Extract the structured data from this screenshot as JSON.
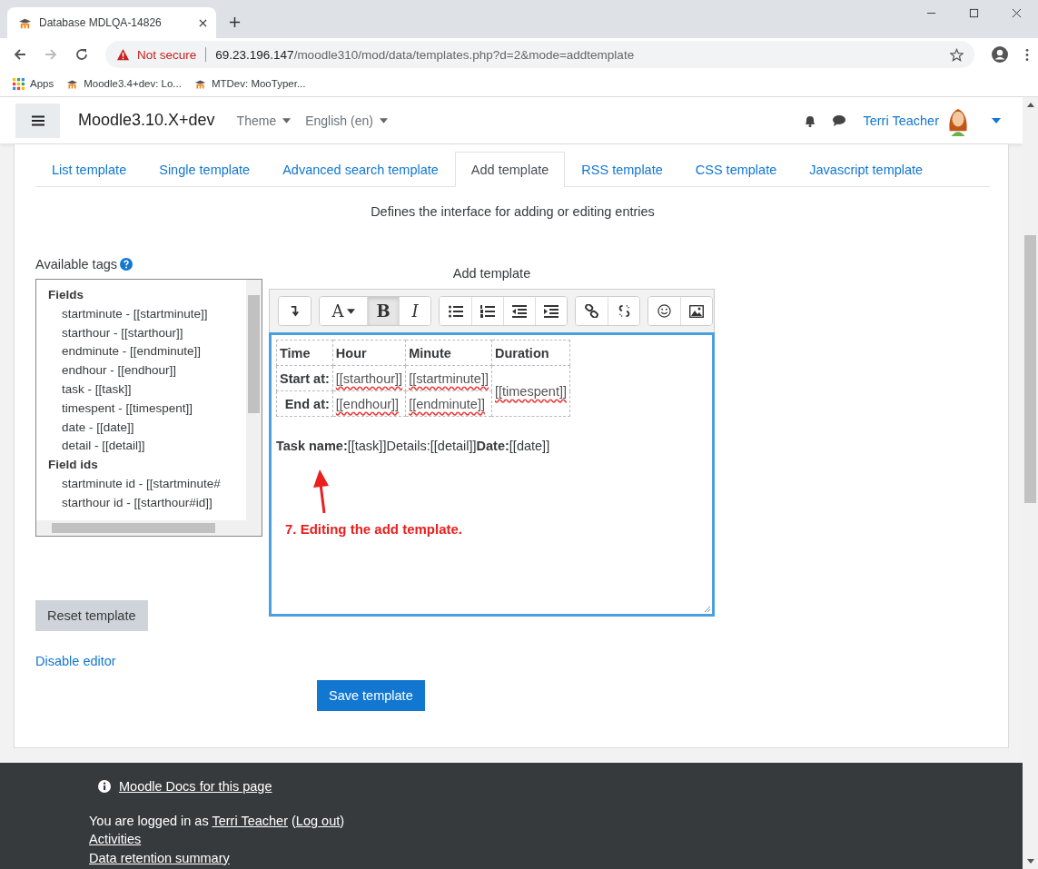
{
  "browser": {
    "tab_title": "Database MDLQA-14826",
    "security": "Not secure",
    "url_host": "69.23.196.147",
    "url_path": "/moodle310/mod/data/templates.php?d=2&mode=addtemplate",
    "bookmarks": [
      "Apps",
      "Moodle3.4+dev: Lo...",
      "MTDev: MooTyper..."
    ]
  },
  "navbar": {
    "site_name": "Moodle3.10.X+dev",
    "menus": [
      "Theme",
      "English (en)"
    ],
    "user": "Terri Teacher"
  },
  "tabs": [
    {
      "label": "List template",
      "selected": false
    },
    {
      "label": "Single template",
      "selected": false
    },
    {
      "label": "Advanced search template",
      "selected": false
    },
    {
      "label": "Add template",
      "selected": true
    },
    {
      "label": "RSS template",
      "selected": false
    },
    {
      "label": "CSS template",
      "selected": false
    },
    {
      "label": "Javascript template",
      "selected": false
    }
  ],
  "description": "Defines the interface for adding or editing entries",
  "available_tags": {
    "label": "Available tags",
    "groups": [
      {
        "heading": "Fields",
        "items": [
          "startminute - [[startminute]]",
          "starthour - [[starthour]]",
          "endminute - [[endminute]]",
          "endhour - [[endhour]]",
          "task - [[task]]",
          "timespent - [[timespent]]",
          "date - [[date]]",
          "detail - [[detail]]"
        ]
      },
      {
        "heading": "Field ids",
        "items": [
          "startminute id - [[startminute#",
          "starthour id - [[starthour#id]]"
        ]
      }
    ]
  },
  "editor": {
    "label": "Add template",
    "toolbar": {
      "font_label": "A",
      "bold_label": "B",
      "italic_label": "I",
      "bold_active": true
    },
    "table": [
      [
        "Time",
        "Hour",
        "Minute",
        "Duration"
      ],
      [
        "Start at:",
        "[[starthour]]",
        "[[startminute]]",
        "[[timespent]]"
      ],
      [
        "End at:",
        "[[endhour]]",
        "[[endminute]]"
      ]
    ],
    "paragraph": "**Task name:**[[task]]Details:[[detail]]**Date:**[[date]]",
    "annotation": "7. Editing the add template."
  },
  "buttons": {
    "reset": "Reset template",
    "disable": "Disable editor",
    "save": "Save template"
  },
  "footer": {
    "docs_link": "Moodle Docs for this page",
    "logged_prefix": "You are logged in as",
    "user_link": "Terri Teacher",
    "open_paren": "(",
    "logout_link": "Log out",
    "close_paren": ")",
    "links": [
      "Activities",
      "Data retention summary"
    ]
  }
}
